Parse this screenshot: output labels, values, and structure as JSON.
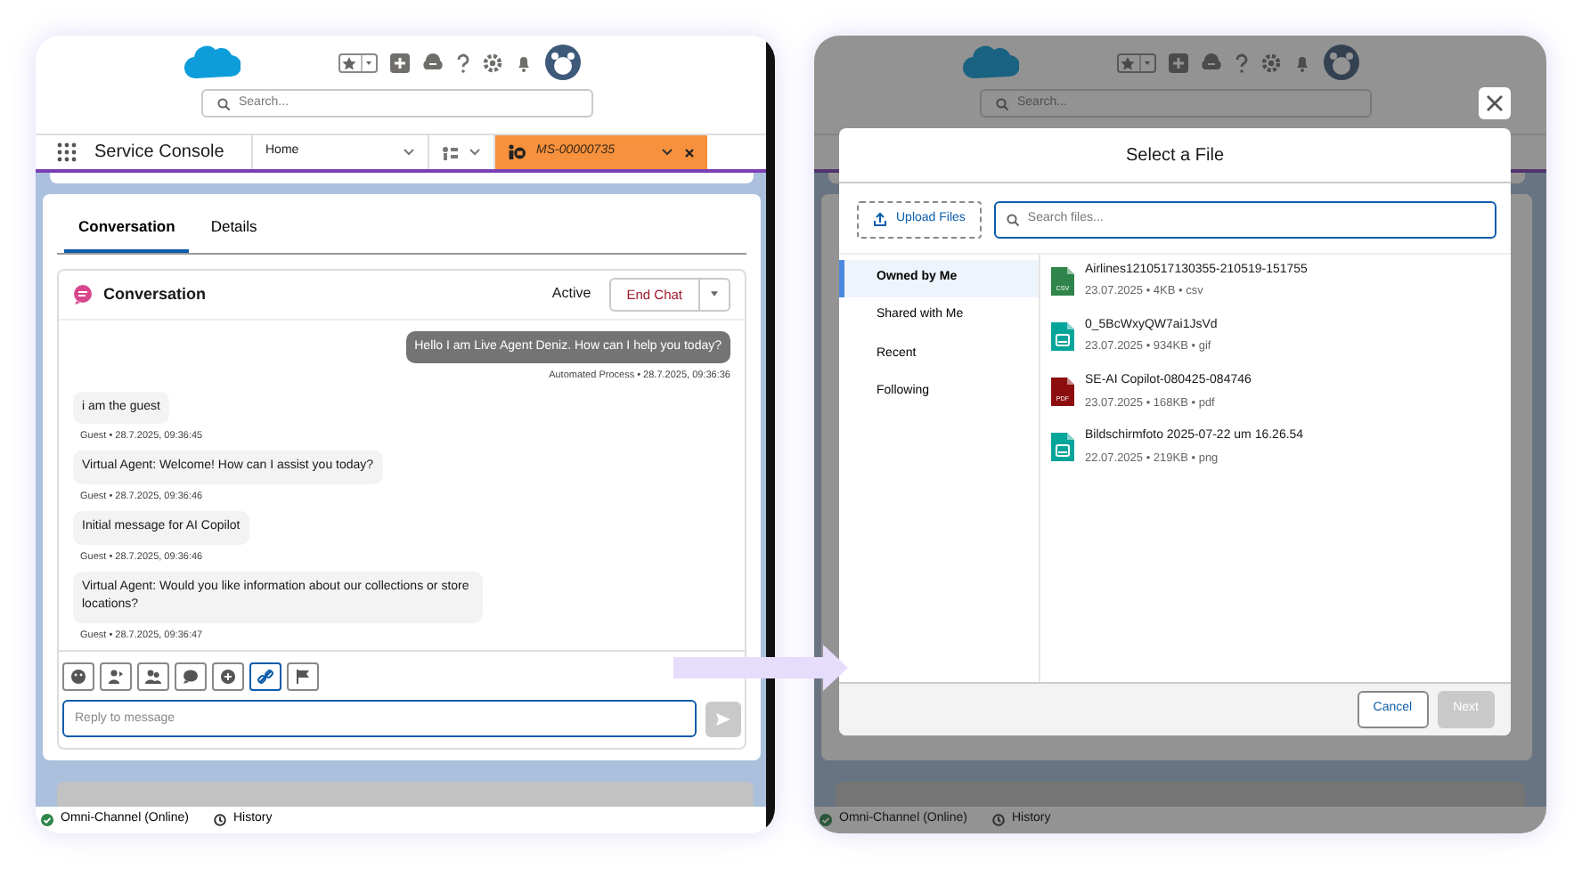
{
  "console": {
    "search_placeholder": "Search...",
    "app_name": "Service Console",
    "nav_tabs": [
      {
        "kind": "home",
        "label": "Home",
        "selected": false
      },
      {
        "kind": "object",
        "selected": false
      },
      {
        "kind": "record",
        "label": "MS-00000735",
        "selected": true
      }
    ],
    "record_tabs": [
      {
        "label": "Conversation",
        "selected": true
      },
      {
        "label": "Details",
        "selected": false
      }
    ],
    "conversation": {
      "title": "Conversation",
      "status": "Active",
      "end_button": "End Chat",
      "messages": [
        {
          "kind": "agent",
          "text": "Hello I am Live Agent Deniz. How can I help you today?",
          "meta": "Automated Process • 28.7.2025, 09:36:36"
        },
        {
          "kind": "guest",
          "text": "i am the guest",
          "meta": "Guest • 28.7.2025, 09:36:45"
        },
        {
          "kind": "guest",
          "text": "Virtual Agent: Welcome! How can I assist you today?",
          "meta": "Guest • 28.7.2025, 09:36:46"
        },
        {
          "kind": "guest",
          "text": "Initial message for AI Copilot",
          "meta": "Guest • 28.7.2025, 09:36:46"
        },
        {
          "kind": "guest",
          "text": "Virtual Agent: Would you like information about our collections or store locations?",
          "meta": "Guest • 28.7.2025, 09:36:47"
        }
      ],
      "tools": [
        {
          "kind": "emoji",
          "hovered": false
        },
        {
          "kind": "transfer",
          "hovered": false
        },
        {
          "kind": "people",
          "hovered": false
        },
        {
          "kind": "chat",
          "hovered": false
        },
        {
          "kind": "chat_add",
          "hovered": false
        },
        {
          "kind": "link",
          "hovered": true
        },
        {
          "kind": "flag",
          "hovered": false
        }
      ],
      "reply_placeholder": "Reply to message"
    },
    "status_bar": {
      "presence": "Omni-Channel (Online)",
      "history": "History"
    }
  },
  "file_picker_view": {
    "search_placeholder": "Search...",
    "dialog": {
      "title": "Select a File",
      "upload_button": "Upload Files",
      "search_placeholder": "Search files...",
      "sources": [
        {
          "label": "Owned by Me",
          "selected": true
        },
        {
          "label": "Shared with Me",
          "selected": false
        },
        {
          "label": "Recent",
          "selected": false
        },
        {
          "label": "Following",
          "selected": false
        }
      ],
      "files": [
        {
          "kind": "csv",
          "icon_label": "CSV",
          "name": "Airlines1210517130355-210519-151755",
          "meta": "23.07.2025 • 4KB • csv"
        },
        {
          "kind": "image",
          "name": "0_5BcWxyQW7ai1JsVd",
          "meta": "23.07.2025 • 934KB • gif"
        },
        {
          "kind": "pdf",
          "icon_label": "PDF",
          "name": "SE-AI Copilot-080425-084746",
          "meta": "23.07.2025 • 168KB • pdf"
        },
        {
          "kind": "image",
          "name": "Bildschirmfoto 2025-07-22 um 16.26.54",
          "meta": "22.07.2025 • 219KB • png"
        }
      ],
      "cancel_button": "Cancel",
      "next_button": {
        "label": "Next",
        "disabled": true
      }
    },
    "status_bar": {
      "presence": "Omni-Channel (Online)",
      "history": "History"
    }
  }
}
